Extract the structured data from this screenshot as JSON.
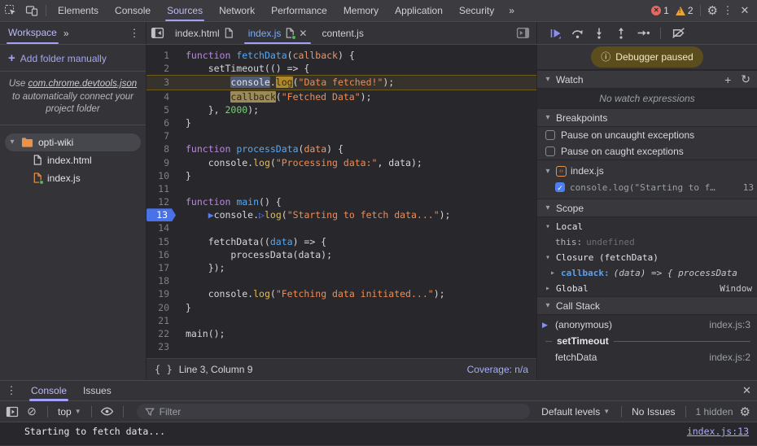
{
  "top_bar": {
    "tabs": [
      "Elements",
      "Console",
      "Sources",
      "Network",
      "Performance",
      "Memory",
      "Application",
      "Security"
    ],
    "selected_tab": "Sources",
    "more_tabs": "»",
    "error_count": "1",
    "warning_count": "2"
  },
  "workspace_panel": {
    "title": "Workspace",
    "more": "»",
    "add_folder_label": "Add folder manually",
    "hint_pre": "Use",
    "hint_link": "com.chrome.devtools.json",
    "hint_post": "to automatically connect your project folder",
    "folder": "opti-wiki",
    "files": {
      "html": "index.html",
      "js": "index.js"
    }
  },
  "editor": {
    "tabs": {
      "tab1": "index.html",
      "tab2": "index.js",
      "tab3": "content.js"
    },
    "status": {
      "line_col": "Line 3, Column 9",
      "coverage": "Coverage: n/a",
      "braces": "{ }"
    },
    "code_lines": [
      {
        "n": 1,
        "t": [
          [
            "k",
            "function"
          ],
          [
            "p",
            " "
          ],
          [
            "f",
            "fetchData"
          ],
          [
            "p",
            "("
          ],
          [
            "o",
            "callback"
          ],
          [
            "p",
            ") {"
          ]
        ]
      },
      {
        "n": 2,
        "t": [
          [
            "p",
            "    setTimeout(() => {"
          ]
        ]
      },
      {
        "n": 3,
        "exec": true,
        "t": [
          [
            "p",
            "        "
          ],
          [
            "selc",
            "console"
          ],
          [
            "p",
            "."
          ],
          [
            "sell",
            "log"
          ],
          [
            "p",
            "("
          ],
          [
            "s",
            "\"Data fetched!\""
          ],
          [
            "p",
            ");"
          ]
        ]
      },
      {
        "n": 4,
        "t": [
          [
            "p",
            "        "
          ],
          [
            "selt",
            "callback"
          ],
          [
            "p",
            "("
          ],
          [
            "s",
            "\"Fetched Data\""
          ],
          [
            "p",
            ");"
          ]
        ]
      },
      {
        "n": 5,
        "t": [
          [
            "p",
            "    }, "
          ],
          [
            "n",
            "2000"
          ],
          [
            "p",
            ");"
          ]
        ]
      },
      {
        "n": 6,
        "t": [
          [
            "p",
            "}"
          ]
        ]
      },
      {
        "n": 7,
        "t": []
      },
      {
        "n": 8,
        "t": [
          [
            "k",
            "function"
          ],
          [
            "p",
            " "
          ],
          [
            "f",
            "processData"
          ],
          [
            "p",
            "("
          ],
          [
            "o",
            "data"
          ],
          [
            "p",
            ") {"
          ]
        ]
      },
      {
        "n": 9,
        "t": [
          [
            "p",
            "    console."
          ],
          [
            "y",
            "log"
          ],
          [
            "p",
            "("
          ],
          [
            "s",
            "\"Processing data:\""
          ],
          [
            "p",
            ", data);"
          ]
        ]
      },
      {
        "n": 10,
        "t": [
          [
            "p",
            "}"
          ]
        ]
      },
      {
        "n": 11,
        "t": []
      },
      {
        "n": 12,
        "t": [
          [
            "k",
            "function"
          ],
          [
            "p",
            " "
          ],
          [
            "f",
            "main"
          ],
          [
            "p",
            "() {"
          ]
        ]
      },
      {
        "n": 13,
        "bp": true,
        "t": [
          [
            "p",
            "    "
          ],
          [
            "mf",
            "▶"
          ],
          [
            "p",
            "console."
          ],
          [
            "mo",
            "▷"
          ],
          [
            "y",
            "log"
          ],
          [
            "p",
            "("
          ],
          [
            "s",
            "\"Starting to fetch data...\""
          ],
          [
            "p",
            ");"
          ]
        ]
      },
      {
        "n": 14,
        "t": []
      },
      {
        "n": 15,
        "t": [
          [
            "p",
            "    fetchData(("
          ],
          [
            "b",
            "data"
          ],
          [
            "p",
            ") => {"
          ]
        ]
      },
      {
        "n": 16,
        "t": [
          [
            "p",
            "        processData(data);"
          ]
        ]
      },
      {
        "n": 17,
        "t": [
          [
            "p",
            "    });"
          ]
        ]
      },
      {
        "n": 18,
        "t": []
      },
      {
        "n": 19,
        "t": [
          [
            "p",
            "    console."
          ],
          [
            "y",
            "log"
          ],
          [
            "p",
            "("
          ],
          [
            "s",
            "\"Fetching data initiated...\""
          ],
          [
            "p",
            ");"
          ]
        ]
      },
      {
        "n": 20,
        "t": [
          [
            "p",
            "}"
          ]
        ]
      },
      {
        "n": 21,
        "t": []
      },
      {
        "n": 22,
        "t": [
          [
            "p",
            "main();"
          ]
        ]
      },
      {
        "n": 23,
        "t": []
      }
    ]
  },
  "debugger_panel": {
    "paused_label": "Debugger paused",
    "info_icon": "ⓘ",
    "watch": {
      "title": "Watch",
      "empty": "No watch expressions",
      "add_icon": "+",
      "refresh_icon": "↻"
    },
    "breakpoints": {
      "title": "Breakpoints",
      "pause_uncaught": "Pause on uncaught exceptions",
      "pause_caught": "Pause on caught exceptions",
      "file": "index.js",
      "entry_code": "console.log(\"Starting to f…",
      "entry_line": "13",
      "check": "✓"
    },
    "scope": {
      "title": "Scope",
      "local": "Local",
      "this_name": "this:",
      "this_value": "undefined",
      "closure": "Closure (fetchData)",
      "callback_name": "callback:",
      "callback_value": "(data) => { processData",
      "global": "Global",
      "global_value": "Window"
    },
    "call_stack": {
      "title": "Call Stack",
      "frame1": "(anonymous)",
      "frame1_loc": "index.js:3",
      "async_label": "setTimeout",
      "frame2": "fetchData",
      "frame2_loc": "index.js:2"
    }
  },
  "drawer": {
    "tabs": {
      "console": "Console",
      "issues": "Issues"
    },
    "context_selector": "top",
    "filter_placeholder": "Filter",
    "default_levels": "Default levels",
    "no_issues": "No Issues",
    "hidden_count": "1 hidden",
    "message": "Starting to fetch data...",
    "message_link": "index.js:13"
  }
}
